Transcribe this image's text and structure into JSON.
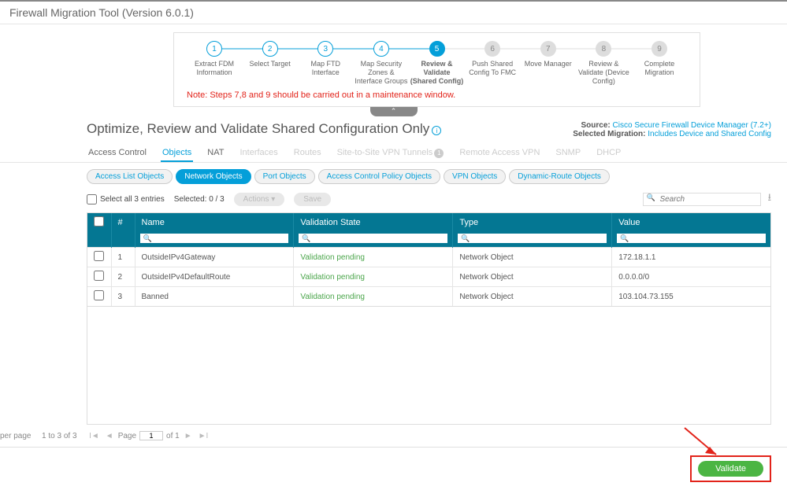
{
  "app_title": "Firewall Migration Tool (Version 6.0.1)",
  "steps": [
    {
      "num": "1",
      "label": "Extract FDM Information",
      "state": "done"
    },
    {
      "num": "2",
      "label": "Select Target",
      "state": "done"
    },
    {
      "num": "3",
      "label": "Map FTD Interface",
      "state": "done"
    },
    {
      "num": "4",
      "label": "Map Security Zones & Interface Groups",
      "state": "done"
    },
    {
      "num": "5",
      "label": "Review & Validate (Shared Config)",
      "state": "current"
    },
    {
      "num": "6",
      "label": "Push Shared Config To FMC",
      "state": "future"
    },
    {
      "num": "7",
      "label": "Move Manager",
      "state": "future"
    },
    {
      "num": "8",
      "label": "Review & Validate (Device Config)",
      "state": "future"
    },
    {
      "num": "9",
      "label": "Complete Migration",
      "state": "future"
    }
  ],
  "note": "Note: Steps 7,8 and 9 should be carried out in a maintenance window.",
  "page_title": "Optimize, Review and Validate Shared Configuration Only",
  "source_label": "Source: ",
  "source_value": "Cisco Secure Firewall Device Manager (7.2+)",
  "mig_label": "Selected Migration: ",
  "mig_value": "Includes Device and Shared Config",
  "tabs1": [
    {
      "label": "Access Control",
      "state": "normal"
    },
    {
      "label": "Objects",
      "state": "active"
    },
    {
      "label": "NAT",
      "state": "normal"
    },
    {
      "label": "Interfaces",
      "state": "disabled"
    },
    {
      "label": "Routes",
      "state": "disabled"
    },
    {
      "label": "Site-to-Site VPN Tunnels",
      "state": "disabled",
      "badge": "1"
    },
    {
      "label": "Remote Access VPN",
      "state": "disabled"
    },
    {
      "label": "SNMP",
      "state": "disabled"
    },
    {
      "label": "DHCP",
      "state": "disabled"
    }
  ],
  "tabs2": [
    {
      "label": "Access List Objects",
      "state": ""
    },
    {
      "label": "Network Objects",
      "state": "active"
    },
    {
      "label": "Port Objects",
      "state": ""
    },
    {
      "label": "Access Control Policy Objects",
      "state": ""
    },
    {
      "label": "VPN Objects",
      "state": ""
    },
    {
      "label": "Dynamic-Route Objects",
      "state": ""
    }
  ],
  "toolbar": {
    "select_all": "Select all 3 entries",
    "selected": "Selected: 0 / 3",
    "actions": "Actions ▾",
    "save": "Save",
    "search_placeholder": "Search"
  },
  "columns": {
    "chk": "",
    "idx": "#",
    "name": "Name",
    "validation": "Validation State",
    "type": "Type",
    "value": "Value"
  },
  "rows": [
    {
      "idx": "1",
      "name": "OutsideIPv4Gateway",
      "validation": "Validation pending",
      "type": "Network Object",
      "value": "172.18.1.1"
    },
    {
      "idx": "2",
      "name": "OutsideIPv4DefaultRoute",
      "validation": "Validation pending",
      "type": "Network Object",
      "value": "0.0.0.0/0"
    },
    {
      "idx": "3",
      "name": "Banned",
      "validation": "Validation pending",
      "type": "Network Object",
      "value": "103.104.73.155"
    }
  ],
  "pager": {
    "per": "per page",
    "range": "1 to 3 of 3",
    "page_lbl": "Page",
    "page_val": "1",
    "of": "of 1"
  },
  "validate_btn": "Validate"
}
